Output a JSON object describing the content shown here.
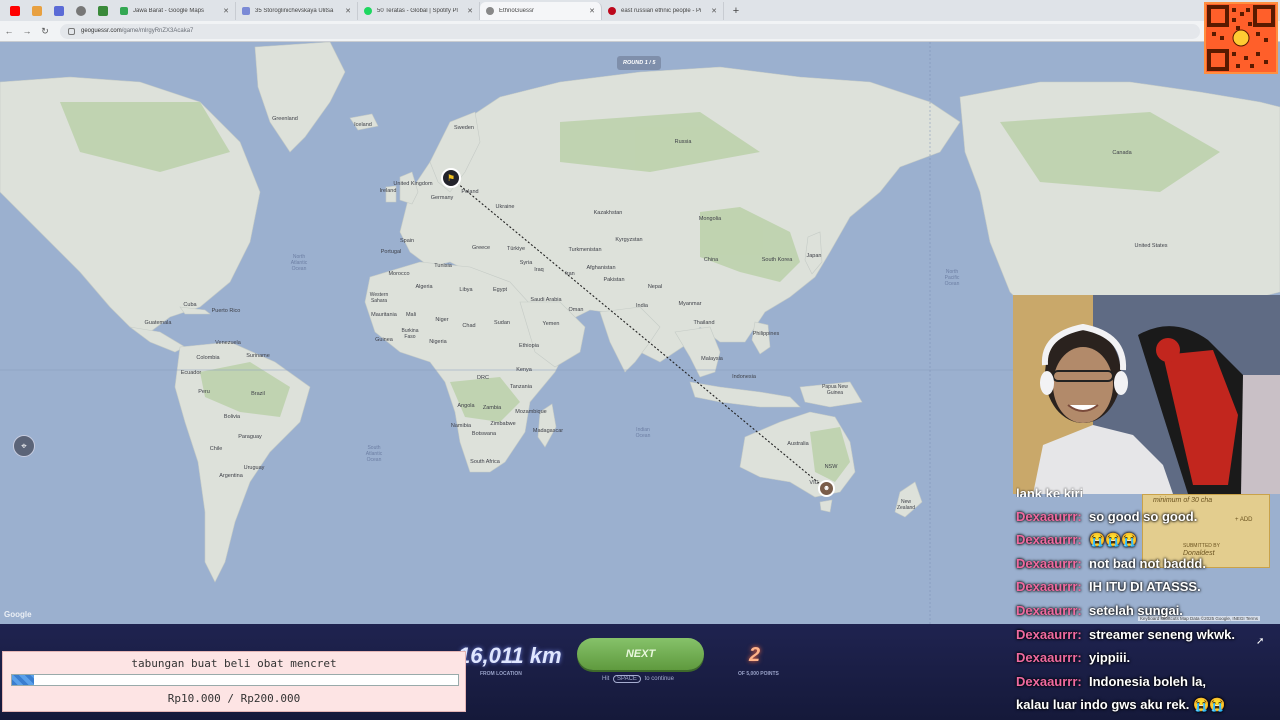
{
  "browser": {
    "tabs": [
      {
        "label": "Jawa Barat - Google Maps",
        "color": "#34a853"
      },
      {
        "label": "35 Storoglinichevskaya Ulitsa",
        "color": "#7b8ad6"
      },
      {
        "label": "50 Teratas - Global | Spotify Pl",
        "color": "#1ed760"
      },
      {
        "label": "EthnoGuessr",
        "color": "#888"
      },
      {
        "label": "east russian ethnic people - Pi",
        "color": "#bd081c"
      }
    ],
    "url_host": "geoguessr.com",
    "url_path": "/game/mlrgyRnZX3Acaka7"
  },
  "map": {
    "round_label": "ROUND 1 / 5",
    "google_label": "Google",
    "credit": "Keyboard shortcuts   Map Data ©2025 Google, INEGI   Terms",
    "labels": {
      "greenland": "Greenland",
      "iceland": "Iceland",
      "sweden": "Sweden",
      "russia": "Russia",
      "uk": "United Kingdom",
      "ireland": "Ireland",
      "germany": "Germany",
      "poland": "Poland",
      "ukraine": "Ukraine",
      "spain": "Spain",
      "portugal": "Portugal",
      "greece": "Greece",
      "turkiye": "Türkiye",
      "kazakhstan": "Kazakhstan",
      "mongolia": "Mongolia",
      "kyrgyzstan": "Kyrgyzstan",
      "turkmenistan": "Turkmenistan",
      "afghanistan": "Afghanistan",
      "pakistan": "Pakistan",
      "china": "China",
      "south_korea": "South Korea",
      "japan": "Japan",
      "morocco": "Morocco",
      "algeria": "Algeria",
      "tunisia": "Tunisia",
      "libya": "Libya",
      "egypt": "Egypt",
      "syria": "Syria",
      "iraq": "Iraq",
      "iran": "Iran",
      "saudi": "Saudi Arabia",
      "oman": "Oman",
      "yemen": "Yemen",
      "nepal": "Nepal",
      "india": "India",
      "myanmar": "Myanmar",
      "thailand": "Thailand",
      "philippines": "Philippines",
      "malaysia": "Malaysia",
      "indonesia": "Indonesia",
      "png": "Papua New\nGuinea",
      "australia": "Australia",
      "nz": "New\nZealand",
      "w_sahara": "Western\nSahara",
      "mauritania": "Mauritania",
      "mali": "Mali",
      "niger": "Niger",
      "chad": "Chad",
      "sudan": "Sudan",
      "ethiopia": "Ethiopia",
      "burkina": "Burkina\nFaso",
      "guinea": "Guinea",
      "nigeria": "Nigeria",
      "drc": "DRC",
      "kenya": "Kenya",
      "tanzania": "Tanzania",
      "angola": "Angola",
      "zambia": "Zambia",
      "mozambique": "Mozambique",
      "madagascar": "Madagascar",
      "namibia": "Namibia",
      "botswana": "Botswana",
      "zimbabwe": "Zimbabwe",
      "south_africa": "South Africa",
      "canada": "Canada",
      "usa": "United States",
      "cuba": "Cuba",
      "puerto_rico": "Puerto Rico",
      "guatemala": "Guatemala",
      "venezuela": "Venezuela",
      "colombia": "Colombia",
      "suriname": "Suriname",
      "ecuador": "Ecuador",
      "peru": "Peru",
      "brazil": "Brazil",
      "bolivia": "Bolivia",
      "paraguay": "Paraguay",
      "chile": "Chile",
      "uruguay": "Uruguay",
      "argentina": "Argentina",
      "nsw": "NSW",
      "vic": "VIC"
    },
    "oceans": {
      "north_atlantic": "North\nAtlantic\nOcean",
      "south_atlantic": "South\nAtlantic\nOcean",
      "indian": "Indian\nOcean",
      "north_pacific": "North\nPacific\nOcean"
    }
  },
  "results": {
    "distance": "16,011 km",
    "distance_sub": "FROM LOCATION",
    "next_label": "NEXT",
    "hint_pre": "Hit",
    "hint_key": "SPACE",
    "hint_post": "to continue",
    "score": "2",
    "score_sub": "OF 5,000 POINTS"
  },
  "savings": {
    "title": "tabungan buat beli obat mencret",
    "amount": "Rp10.000 / Rp200.000",
    "progress_fraction": 0.05
  },
  "chat": {
    "cut_line": "lank ke kiri",
    "lines": [
      {
        "user": "Dexaaurrr:",
        "msg": "so good so good."
      },
      {
        "user": "Dexaaurrr:",
        "msg": "😭😭😭"
      },
      {
        "user": "Dexaaurrr:",
        "msg": "not bad not baddd."
      },
      {
        "user": "Dexaaurrr:",
        "msg": "IH ITU DI ATASSS."
      },
      {
        "user": "Dexaaurrr:",
        "msg": "setelah sungai."
      },
      {
        "user": "Dexaaurrr:",
        "msg": "streamer seneng wkwk."
      },
      {
        "user": "Dexaaurrr:",
        "msg": "yippiii."
      },
      {
        "user": "Dexaaurrr:",
        "msg": "Indonesia boleh la,"
      },
      {
        "user": "",
        "msg": "kalau luar indo gws aku rek. 😭😭"
      }
    ]
  },
  "card": {
    "top": "minimum of 30 cha",
    "add": "+ ADD",
    "submitted": "SUBMITTED BY",
    "name": "Donaldest"
  }
}
